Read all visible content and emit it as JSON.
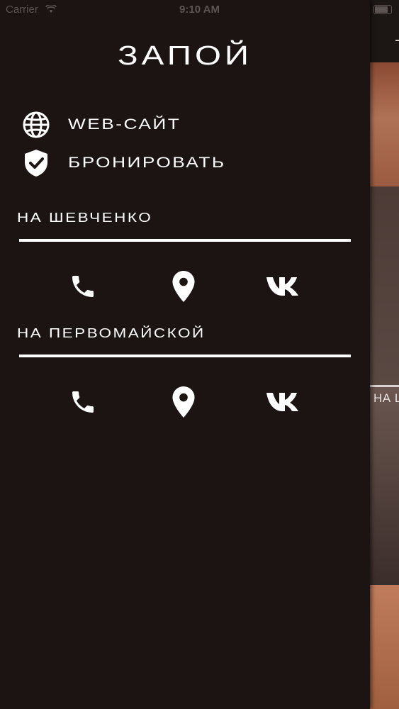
{
  "status_bar": {
    "carrier": "Carrier",
    "time": "9:10 AM"
  },
  "drawer": {
    "title": "ЗАПОЙ",
    "menu": [
      {
        "label": "WEB-САЙТ",
        "icon": "globe-icon"
      },
      {
        "label": "БРОНИРОВАТЬ",
        "icon": "shield-check-icon"
      }
    ],
    "locations": [
      {
        "title": "НА ШЕВЧЕНКО",
        "actions": [
          "phone-icon",
          "map-pin-icon",
          "vk-icon"
        ]
      },
      {
        "title": "НА ПЕРВОМАЙСКОЙ",
        "actions": [
          "phone-icon",
          "map-pin-icon",
          "vk-icon"
        ]
      }
    ]
  },
  "background": {
    "partial_label": "НА Ш"
  },
  "colors": {
    "drawer_bg": "#1b1413",
    "text": "#ffffff",
    "status_text": "#5d5452"
  }
}
